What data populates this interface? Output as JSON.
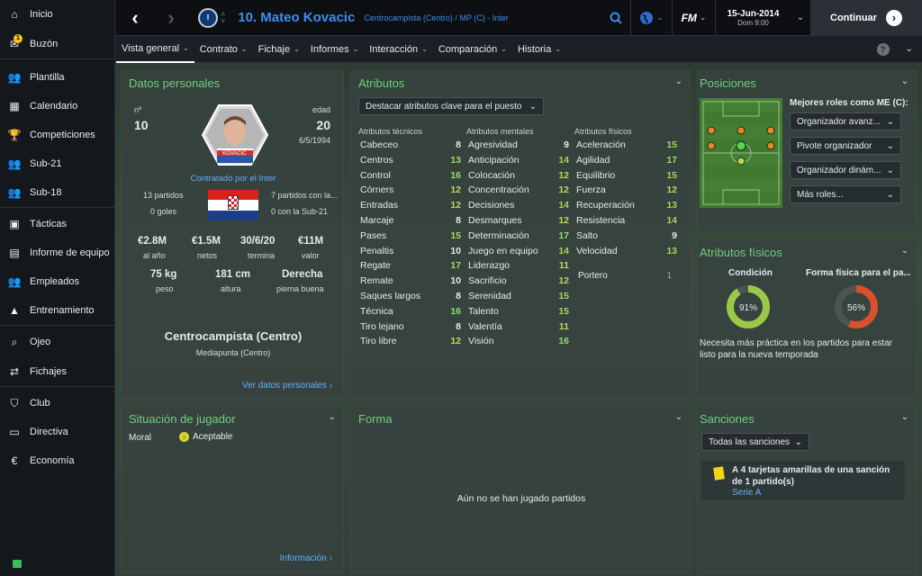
{
  "sidebar": {
    "items": [
      {
        "label": "Inicio",
        "icon": "home-icon"
      },
      {
        "label": "Buzón",
        "icon": "inbox-icon",
        "badge": "1"
      },
      {
        "label": "Plantilla",
        "icon": "squad-icon"
      },
      {
        "label": "Calendario",
        "icon": "calendar-icon"
      },
      {
        "label": "Competiciones",
        "icon": "trophy-icon"
      },
      {
        "label": "Sub-21",
        "icon": "under21-icon"
      },
      {
        "label": "Sub-18",
        "icon": "under18-icon"
      },
      {
        "label": "Tácticas",
        "icon": "tactics-icon"
      },
      {
        "label": "Informe de equipo",
        "icon": "report-icon"
      },
      {
        "label": "Empleados",
        "icon": "staff-icon"
      },
      {
        "label": "Entrenamiento",
        "icon": "training-icon"
      },
      {
        "label": "Ojeo",
        "icon": "scouting-icon"
      },
      {
        "label": "Fichajes",
        "icon": "transfers-icon"
      },
      {
        "label": "Club",
        "icon": "club-icon"
      },
      {
        "label": "Directiva",
        "icon": "board-icon"
      },
      {
        "label": "Economía",
        "icon": "finance-icon"
      }
    ]
  },
  "topbar": {
    "player_title": "10. Mateo Kovacic",
    "player_subtitle": "Centrocampista (Centro) / MP (C) - Inter",
    "logo": "FM",
    "date": "15-Jun-2014",
    "time": "Dom 9:00",
    "continue_label": "Continuar"
  },
  "menu": {
    "tabs": [
      "Vista general",
      "Contrato",
      "Fichaje",
      "Informes",
      "Interacción",
      "Comparación",
      "Historia"
    ]
  },
  "personal": {
    "title": "Datos personales",
    "number_label": "nº",
    "number": "10",
    "age_label": "edad",
    "age": "20",
    "dob": "6/5/1994",
    "shirt_name": "KOVACIC",
    "contracted": "Contratado por el Inter",
    "matches": "13 partidos",
    "goals": "0 goles",
    "u21_matches": "7 partidos con la...",
    "u21_goals": "0 con la Sub-21",
    "wage": "€2.8M",
    "wage_label": "al año",
    "net": "€1.5M",
    "net_label": "netos",
    "contract_end": "30/6/20",
    "contract_end_label": "termina",
    "value": "€11M",
    "value_label": "valor",
    "weight": "75 kg",
    "weight_label": "peso",
    "height": "181 cm",
    "height_label": "altura",
    "foot": "Derecha",
    "foot_label": "pierna buena",
    "position": "Centrocampista (Centro)",
    "position_sub": "Mediapunta (Centro)",
    "link": "Ver datos personales"
  },
  "attributes": {
    "title": "Atributos",
    "highlight_label": "Destacar atributos clave para el puesto",
    "technical_head": "Atributos técnicos",
    "mental_head": "Atributos mentales",
    "physical_head": "Atributos físicos",
    "technical": [
      {
        "name": "Cabeceo",
        "value": "8"
      },
      {
        "name": "Centros",
        "value": "13"
      },
      {
        "name": "Control",
        "value": "16"
      },
      {
        "name": "Córners",
        "value": "12"
      },
      {
        "name": "Entradas",
        "value": "12"
      },
      {
        "name": "Marcaje",
        "value": "8"
      },
      {
        "name": "Pases",
        "value": "15"
      },
      {
        "name": "Penaltis",
        "value": "10"
      },
      {
        "name": "Regate",
        "value": "17"
      },
      {
        "name": "Remate",
        "value": "10"
      },
      {
        "name": "Saques largos",
        "value": "8"
      },
      {
        "name": "Técnica",
        "value": "16"
      },
      {
        "name": "Tiro lejano",
        "value": "8"
      },
      {
        "name": "Tiro libre",
        "value": "12"
      }
    ],
    "mental": [
      {
        "name": "Agresividad",
        "value": "9"
      },
      {
        "name": "Anticipación",
        "value": "14"
      },
      {
        "name": "Colocación",
        "value": "12"
      },
      {
        "name": "Concentración",
        "value": "12"
      },
      {
        "name": "Decisiones",
        "value": "14"
      },
      {
        "name": "Desmarques",
        "value": "12"
      },
      {
        "name": "Determinación",
        "value": "17"
      },
      {
        "name": "Juego en equipo",
        "value": "14"
      },
      {
        "name": "Liderazgo",
        "value": "11"
      },
      {
        "name": "Sacrificio",
        "value": "12"
      },
      {
        "name": "Serenidad",
        "value": "15"
      },
      {
        "name": "Talento",
        "value": "15"
      },
      {
        "name": "Valentía",
        "value": "11"
      },
      {
        "name": "Visión",
        "value": "16"
      }
    ],
    "physical": [
      {
        "name": "Aceleración",
        "value": "15"
      },
      {
        "name": "Agilidad",
        "value": "17"
      },
      {
        "name": "Equilibrio",
        "value": "15"
      },
      {
        "name": "Fuerza",
        "value": "12"
      },
      {
        "name": "Recuperación",
        "value": "13"
      },
      {
        "name": "Resistencia",
        "value": "14"
      },
      {
        "name": "Salto",
        "value": "9"
      },
      {
        "name": "Velocidad",
        "value": "13"
      }
    ],
    "goalkeeper": {
      "name": "Portero",
      "value": "1"
    }
  },
  "positions": {
    "title": "Posiciones",
    "roles_title": "Mejores roles como ME (C):",
    "roles": [
      "Organizador avanz...",
      "Pivote organizador",
      "Organizador dinám...",
      "Más roles..."
    ]
  },
  "physical_panel": {
    "title": "Atributos físicos",
    "condition_label": "Condición",
    "condition": 91,
    "condition_text": "91%",
    "fitness_label": "Forma física para el pa...",
    "fitness": 56,
    "fitness_text": "56%",
    "note": "Necesita más práctica en los partidos para estar listo para la nueva temporada",
    "colors": {
      "condition": "#9cc84a",
      "fitness": "#d9502a"
    }
  },
  "situation": {
    "title": "Situación de jugador",
    "moral_label": "Moral",
    "moral_value": "Aceptable",
    "link": "Información"
  },
  "form": {
    "title": "Forma",
    "empty": "Aún no se han jugado partidos"
  },
  "sanctions": {
    "title": "Sanciones",
    "filter": "Todas las sanciones",
    "text": "A 4 tarjetas amarillas de una sanción de 1 partido(s)",
    "competition": "Serie A"
  }
}
